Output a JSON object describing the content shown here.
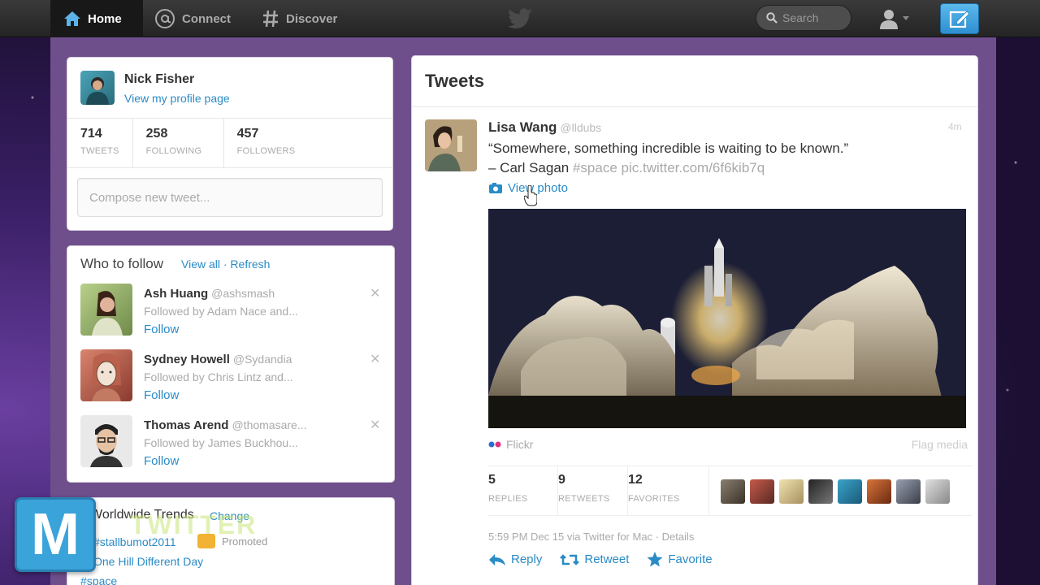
{
  "topbar": {
    "nav": [
      {
        "label": "Home",
        "icon": "home-icon",
        "active": true
      },
      {
        "label": "Connect",
        "icon": "at-icon",
        "active": false
      },
      {
        "label": "Discover",
        "icon": "hash-icon",
        "active": false
      }
    ],
    "search_placeholder": "Search"
  },
  "profile": {
    "name": "Nick Fisher",
    "link": "View my profile page",
    "stats": [
      {
        "num": "714",
        "label": "TWEETS"
      },
      {
        "num": "258",
        "label": "FOLLOWING"
      },
      {
        "num": "457",
        "label": "FOLLOWERS"
      }
    ],
    "compose_placeholder": "Compose new tweet..."
  },
  "who_to_follow": {
    "title": "Who to follow",
    "links": "View all · Refresh",
    "close": "✕",
    "people": [
      {
        "name": "Ash Huang",
        "handle": "@ashsmash",
        "by": "Followed by Adam Nace and...",
        "follow": "Follow"
      },
      {
        "name": "Sydney Howell",
        "handle": "@Sydandia",
        "by": "Followed by Chris Lintz and...",
        "follow": "Follow"
      },
      {
        "name": "Thomas Arend",
        "handle": "@thomasare...",
        "by": "Followed by James Buckhou...",
        "follow": "Follow"
      }
    ]
  },
  "trends": {
    "title": "Worldwide Trends",
    "change": "Change",
    "items": [
      "#stallbumot2011",
      "Promoted",
      "One Hill Different Day",
      "#space"
    ]
  },
  "watermark": {
    "logo_letter": "M",
    "text": "TWITTER"
  },
  "tweets": {
    "title": "Tweets",
    "tweet": {
      "name": "Lisa Wang",
      "handle": "@lldubs",
      "time": "4m",
      "text_line1": "“Somewhere, something incredible is waiting to be known.”",
      "text_line2_author": "– Carl Sagan",
      "text_line2_link": "#space pic.twitter.com/6f6kib7q",
      "view_photo": "View photo",
      "photo_source": "Flickr",
      "flag": "Flag media",
      "stats": [
        {
          "num": "5",
          "label": "REPLIES"
        },
        {
          "num": "9",
          "label": "RETWEETS"
        },
        {
          "num": "12",
          "label": "FAVORITES"
        }
      ],
      "meta": "5:59 PM Dec 15 via Twitter for Mac · Details",
      "actions": [
        {
          "label": "Reply",
          "icon": "reply-icon"
        },
        {
          "label": "Retweet",
          "icon": "retweet-icon"
        },
        {
          "label": "Favorite",
          "icon": "star-icon"
        }
      ]
    }
  },
  "colors": {
    "link": "#2a8bc6",
    "topbar": "#2b2b2b",
    "compose_button": "#3fa3e0",
    "background": "#3a1f66"
  }
}
